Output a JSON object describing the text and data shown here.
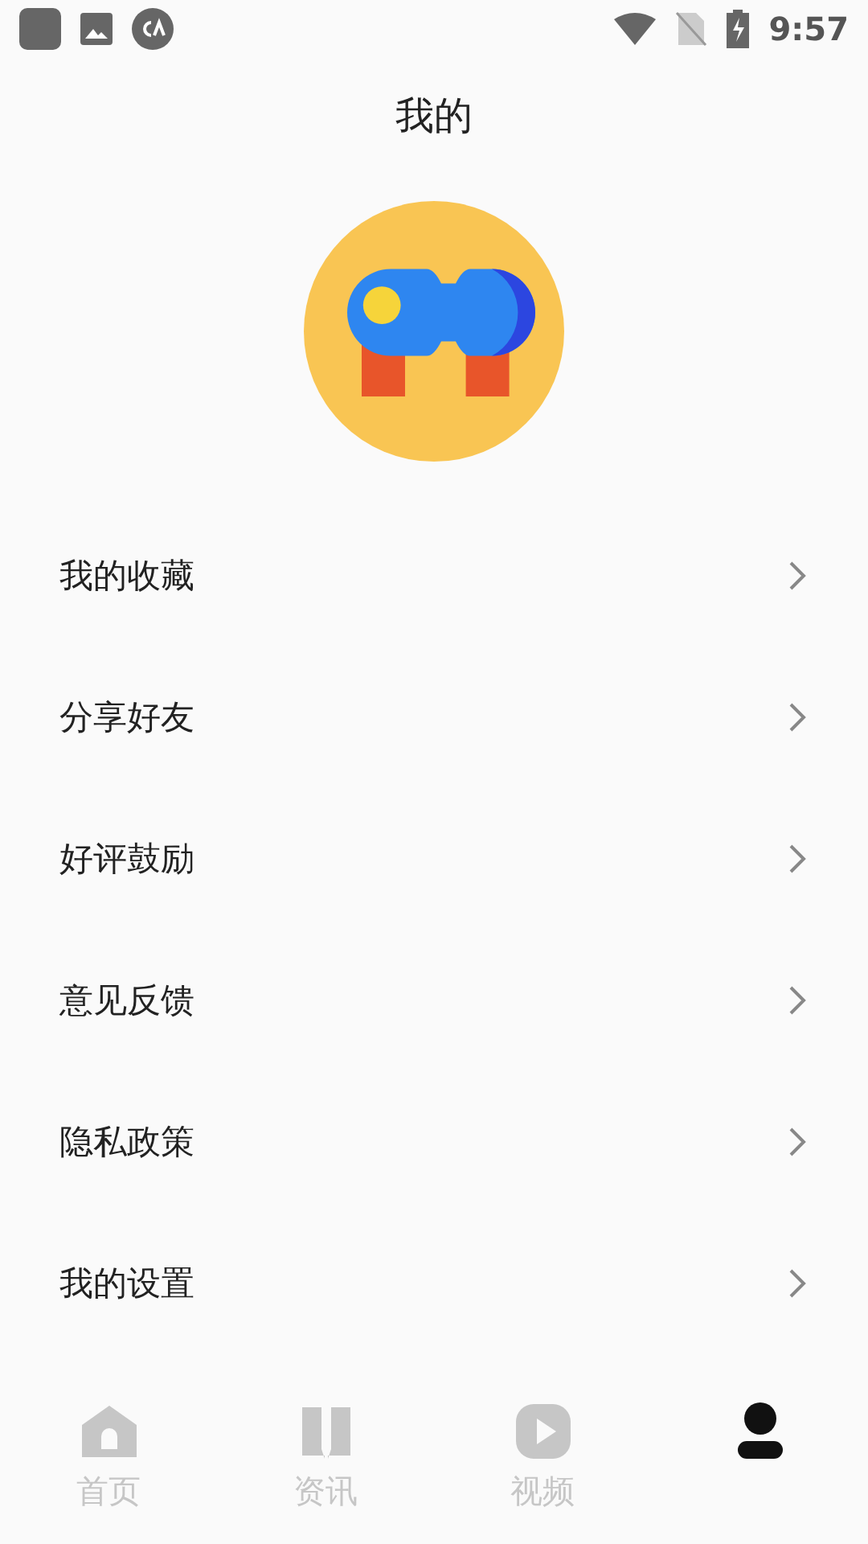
{
  "status_bar": {
    "time": "9:57"
  },
  "title": "我的",
  "menu": [
    {
      "label": "我的收藏"
    },
    {
      "label": "分享好友"
    },
    {
      "label": "好评鼓励"
    },
    {
      "label": "意见反馈"
    },
    {
      "label": "隐私政策"
    },
    {
      "label": "我的设置"
    }
  ],
  "tabs": [
    {
      "kind": "home",
      "label": "首页",
      "selected": false
    },
    {
      "kind": "news",
      "label": "资讯",
      "selected": false
    },
    {
      "kind": "video",
      "label": "视频",
      "selected": false
    },
    {
      "kind": "profile",
      "selected": true
    }
  ]
}
